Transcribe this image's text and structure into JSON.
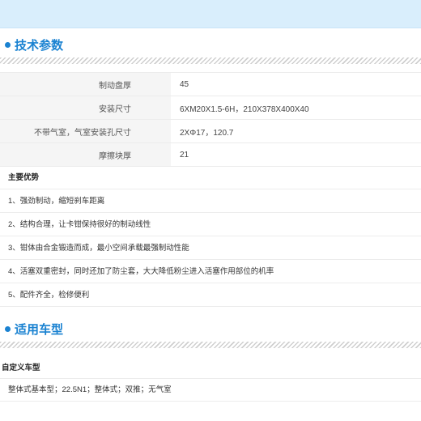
{
  "sections": {
    "params_title": "技术参数",
    "models_title": "适用车型"
  },
  "specs": [
    {
      "label": "制动盘厚",
      "value": "45"
    },
    {
      "label": "安装尺寸",
      "value": "6XM20X1.5-6H，210X378X400X40"
    },
    {
      "label": "不带气室，气室安装孔尺寸",
      "value": "2XΦ17，120.7"
    },
    {
      "label": "摩擦块厚",
      "value": "21"
    }
  ],
  "advantages": {
    "heading": "主要优势",
    "items": [
      "1、强劲制动，缩短刹车距离",
      "2、结构合理，让卡钳保持很好的制动线性",
      "3、钳体由合金锻造而成，最小空间承载最强制动性能",
      "4、活塞双重密封，同时还加了防尘套，大大降低粉尘进入活塞作用部位的机率",
      "5、配件齐全，检修便利"
    ]
  },
  "custom_models": {
    "heading": "自定义车型",
    "row": "整体式基本型；22.5N1；整体式；双推；无气室"
  }
}
